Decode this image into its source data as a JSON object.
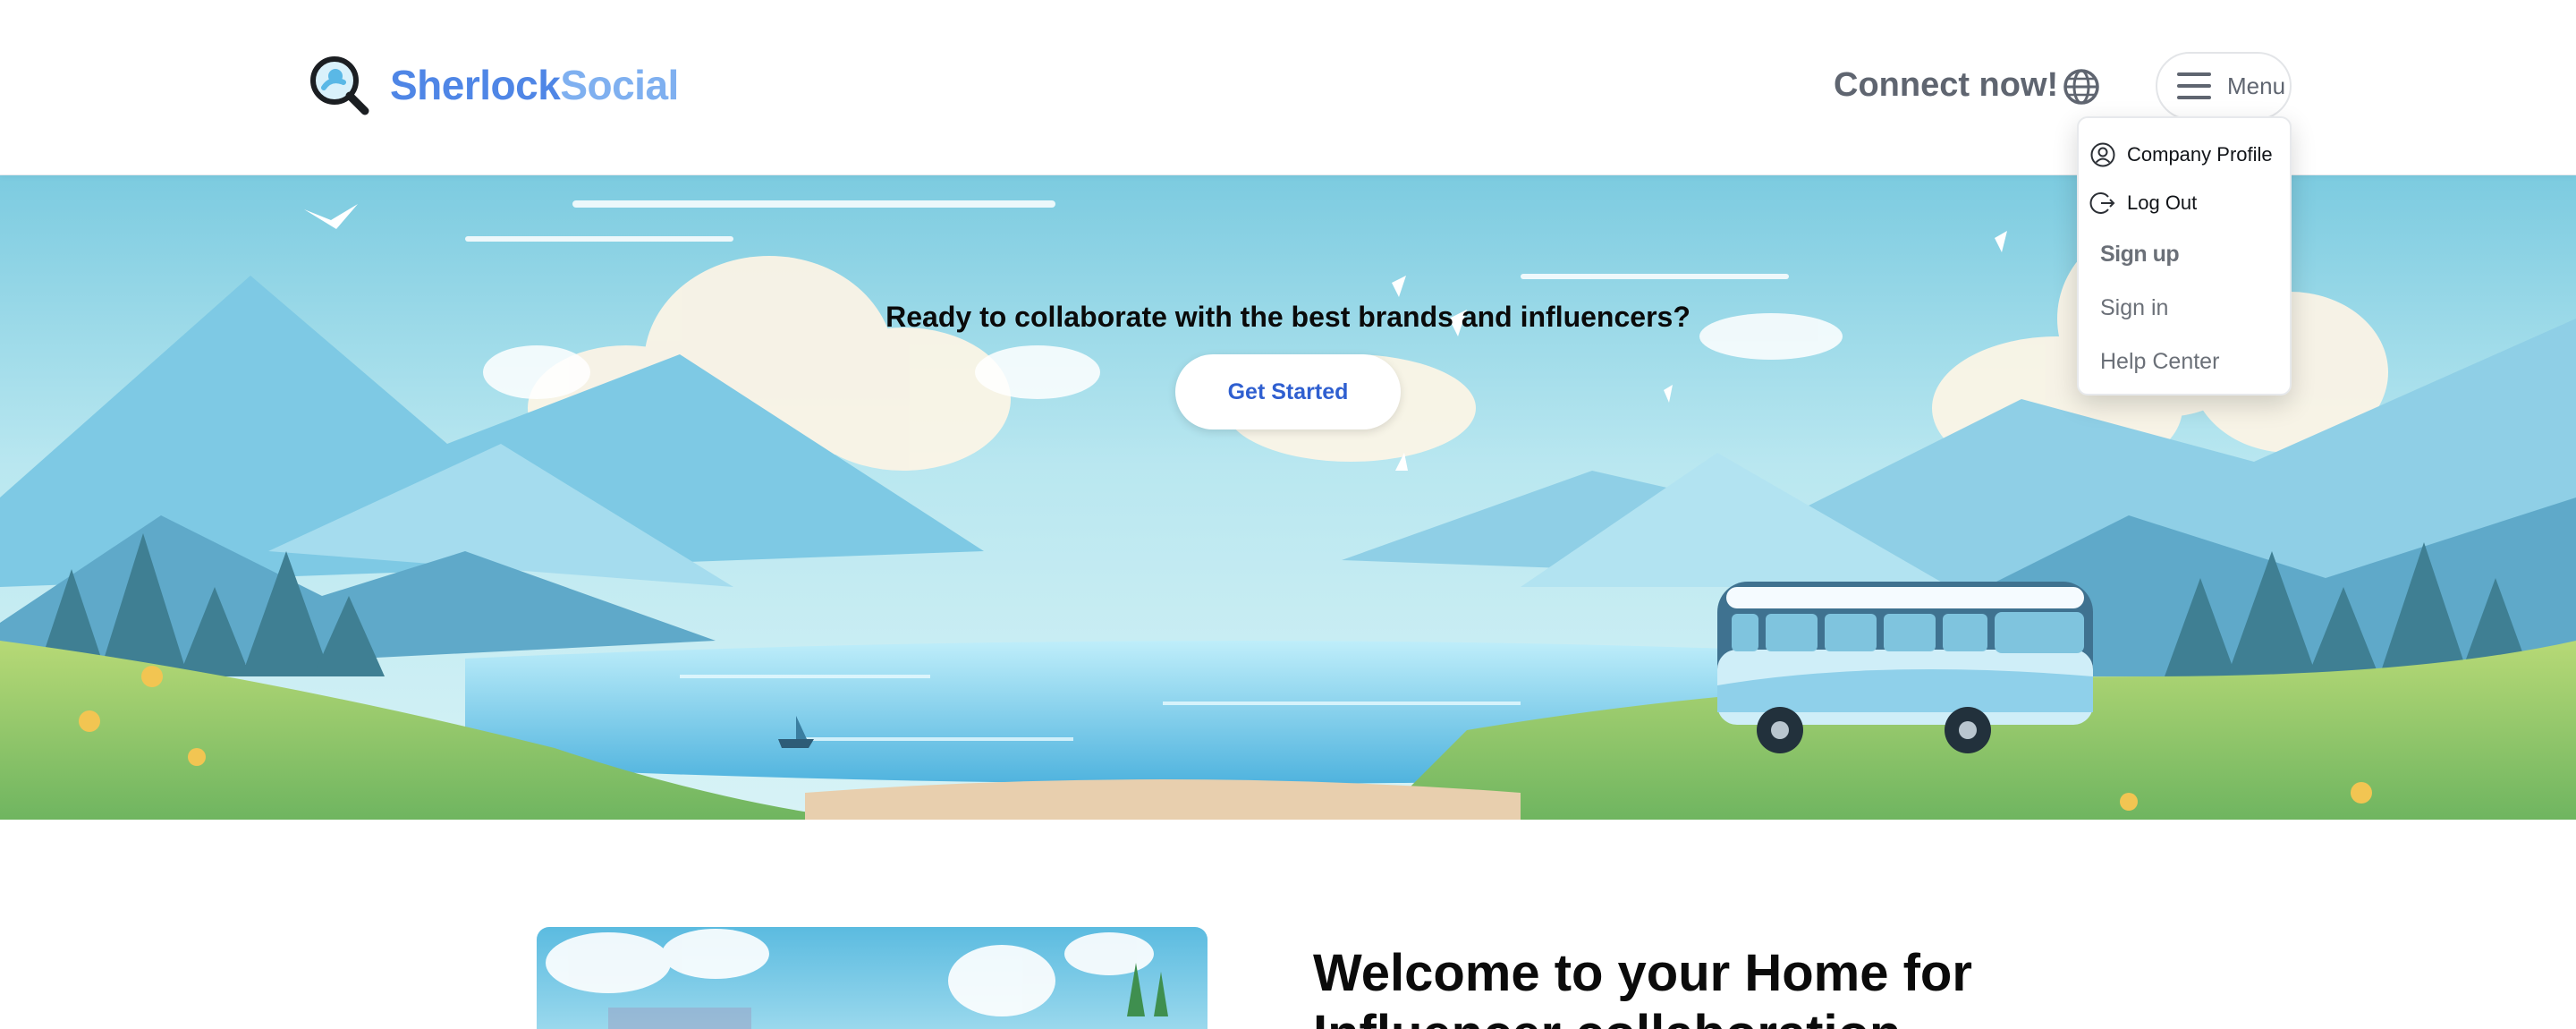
{
  "header": {
    "brand_part1": "Sherlock",
    "brand_part2": "Social",
    "connect_label": "Connect now!",
    "menu_label": "Menu"
  },
  "dropdown": {
    "items": [
      {
        "label": "Company Profile",
        "icon": "user-circle-icon"
      },
      {
        "label": "Log Out",
        "icon": "logout-icon"
      },
      {
        "label": "Sign up"
      },
      {
        "label": "Sign in"
      },
      {
        "label": "Help Center"
      }
    ]
  },
  "hero": {
    "title": "Ready to collaborate with the best brands and influencers?",
    "cta_label": "Get Started"
  },
  "section": {
    "welcome_title": "Welcome to your Home for Influencer collaboration"
  },
  "colors": {
    "brand_primary": "#4f86e6",
    "brand_secondary": "#7fb0f0",
    "cta_text": "#2f5fd0"
  }
}
